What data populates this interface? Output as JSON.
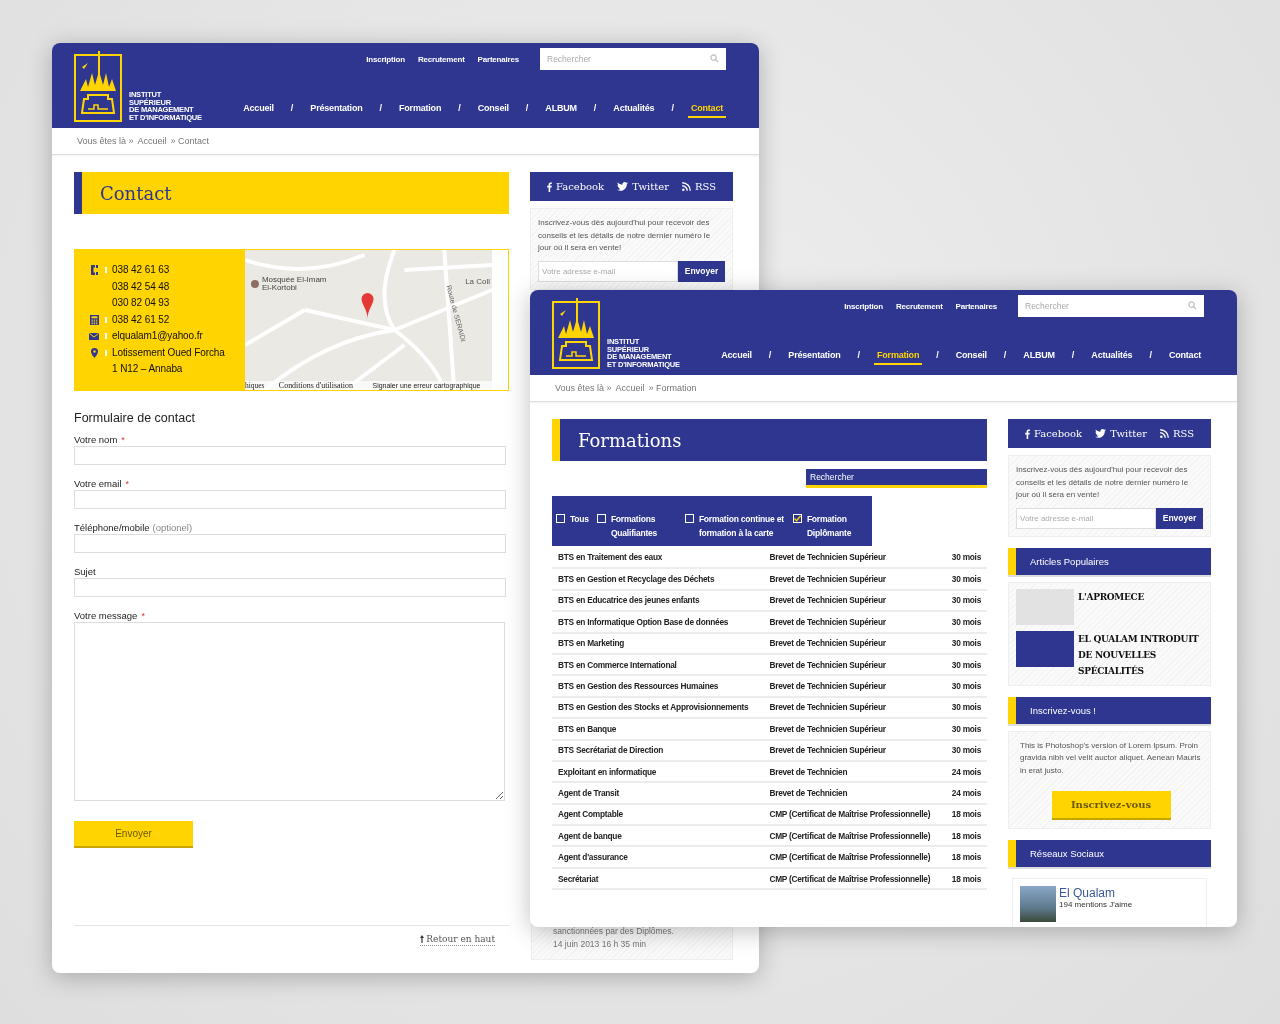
{
  "background_window": {
    "header": {
      "logo_lines": [
        "INSTITUT",
        "SUPÉRIEUR",
        "DE MANAGEMENT",
        "ET D'INFORMATIQUE"
      ],
      "top_links": [
        "Inscription",
        "Recrutement",
        "Partenaires"
      ],
      "search": {
        "placeholder": "Rechercher"
      },
      "nav": [
        {
          "label": "Accueil",
          "selected": false
        },
        {
          "label": "Présentation",
          "selected": false
        },
        {
          "label": "Formation",
          "selected": false
        },
        {
          "label": "Conseil",
          "selected": false
        },
        {
          "label": "ALBUM",
          "selected": false
        },
        {
          "label": "Actualités",
          "selected": false
        },
        {
          "label": "Contact",
          "selected": true
        }
      ],
      "separator": "/"
    },
    "breadcrumb": [
      "Vous êtes là »",
      "Accueil",
      "» Contact"
    ],
    "page_title": {
      "text": "Contact",
      "kind": "highlight"
    },
    "contact": [
      {
        "kind": "phone",
        "lines": [
          "038 42 61 63",
          "038 42 54 48",
          "030 82 04 93"
        ]
      },
      {
        "kind": "fax",
        "lines": [
          "038 42 61 52"
        ]
      },
      {
        "kind": "email",
        "lines": [
          "elqualam1@yahoo.fr"
        ]
      },
      {
        "kind": "address",
        "lines": [
          "Lotissement Oued Forcha",
          "1 N12 – Annaba"
        ]
      }
    ],
    "map": {
      "place": [
        "Mosquée El-Imam",
        "El-Kortobi"
      ],
      "edge_label": "La Coll",
      "road": "Route de SERAIDI",
      "footer": [
        "hiques",
        "Conditions d'utilisation",
        "Signaler une erreur cartographique"
      ]
    },
    "form": {
      "title": "Formulaire de contact",
      "fields": [
        {
          "label": "Votre nom",
          "marker": "*",
          "kind": "text"
        },
        {
          "label": "Votre email",
          "marker": "*",
          "kind": "text"
        },
        {
          "label": "Téléphone/mobile",
          "hint": "(optionel)",
          "kind": "text"
        },
        {
          "label": "Sujet",
          "kind": "text"
        },
        {
          "label": "Votre message",
          "marker": "*",
          "kind": "textarea"
        }
      ],
      "submit": "Envoyer"
    },
    "back_to_top": "Retour en haut",
    "sidebar": {
      "social": [
        {
          "kind": "facebook",
          "label": "Facebook"
        },
        {
          "kind": "twitter",
          "label": "Twitter"
        },
        {
          "kind": "rss",
          "label": "RSS"
        }
      ],
      "newsletter": {
        "text": "Inscrivez-vous dès aujourd'hui pour recevoir des conseils et les détails de notre dernier numéro le jour où il sera en vente!",
        "placeholder": "Votre adresse e-mail",
        "button": "Envoyer"
      },
      "post": {
        "excerpt": "sanctionnées par des Diplômes.",
        "date": "14 juin 2013 16 h 35 min"
      }
    }
  },
  "foreground_window": {
    "header": {
      "logo_lines": [
        "INSTITUT",
        "SUPÉRIEUR",
        "DE MANAGEMENT",
        "ET D'INFORMATIQUE"
      ],
      "top_links": [
        "Inscription",
        "Recrutement",
        "Partenaires"
      ],
      "search": {
        "placeholder": "Rechercher"
      },
      "nav": [
        {
          "label": "Accueil",
          "selected": false
        },
        {
          "label": "Présentation",
          "selected": false
        },
        {
          "label": "Formation",
          "selected": true
        },
        {
          "label": "Conseil",
          "selected": false
        },
        {
          "label": "ALBUM",
          "selected": false
        },
        {
          "label": "Actualités",
          "selected": false
        },
        {
          "label": "Contact",
          "selected": false
        }
      ],
      "separator": "/"
    },
    "breadcrumb": [
      "Vous êtes là »",
      "Accueil",
      "» Formation"
    ],
    "page_title": {
      "text": "Formations",
      "kind": "dark"
    },
    "search_bar": "Rechercher",
    "filters": [
      {
        "label": "Tous",
        "checked": false
      },
      {
        "label": "Formations Qualifiantes",
        "checked": false
      },
      {
        "label": "Formation continue et formation à la carte",
        "checked": false
      },
      {
        "label": "Formation Diplômante",
        "checked": true
      }
    ],
    "rows": [
      [
        "BTS en Traitement des eaux",
        "Brevet de Technicien Supérieur",
        "30 mois"
      ],
      [
        "BTS en Gestion et Recyclage des Déchets",
        "Brevet de Technicien Supérieur",
        "30 mois"
      ],
      [
        "BTS en Educatrice des jeunes enfants",
        "Brevet de Technicien Supérieur",
        "30 mois"
      ],
      [
        "BTS en Informatique Option Base de données",
        "Brevet de Technicien Supérieur",
        "30 mois"
      ],
      [
        "BTS en Marketing",
        "Brevet de Technicien Supérieur",
        "30 mois"
      ],
      [
        "BTS en Commerce International",
        "Brevet de Technicien Supérieur",
        "30 mois"
      ],
      [
        "BTS en Gestion des Ressources Humaines",
        "Brevet de Technicien Supérieur",
        "30 mois"
      ],
      [
        "BTS en Gestion des Stocks et Approvisionnements",
        "Brevet de Technicien Supérieur",
        "30 mois"
      ],
      [
        "BTS en Banque",
        "Brevet de Technicien Supérieur",
        "30 mois"
      ],
      [
        "BTS Secrétariat de Direction",
        "Brevet de Technicien Supérieur",
        "30 mois"
      ],
      [
        "Exploitant en informatique",
        "Brevet de Technicien",
        "24 mois"
      ],
      [
        "Agent de Transit",
        "Brevet de Technicien",
        "24 mois"
      ],
      [
        "Agent Comptable",
        "CMP (Certificat de Maîtrise Professionnelle)",
        "18 mois"
      ],
      [
        "Agent de banque",
        "CMP (Certificat de Maîtrise Professionnelle)",
        "18 mois"
      ],
      [
        "Agent d'assurance",
        "CMP (Certificat de Maîtrise Professionnelle)",
        "18 mois"
      ],
      [
        "Secrétariat",
        "CMP (Certificat de Maîtrise Professionnelle)",
        "18 mois"
      ]
    ],
    "sidebar": {
      "social": [
        {
          "kind": "facebook",
          "label": "Facebook"
        },
        {
          "kind": "twitter",
          "label": "Twitter"
        },
        {
          "kind": "rss",
          "label": "RSS"
        }
      ],
      "newsletter": {
        "text": "Inscrivez-vous dès aujourd'hui pour recevoir des conseils et les détails de notre dernier numéro le jour où il sera en vente!",
        "placeholder": "Votre adresse e-mail",
        "button": "Envoyer"
      },
      "popular": {
        "title": "Articles Populaires",
        "items": [
          {
            "title": "L'APROMECE",
            "kind": "light"
          },
          {
            "title": "EL QUALAM INTRODUIT DE NOUVELLES SPÉCIALITÉS",
            "kind": "dark"
          }
        ]
      },
      "signup": {
        "title": "Inscrivez-vous !",
        "text": "This is Photoshop's version of Lorem Ipsum. Proin gravida nibh vel velit auctor aliquet. Aenean Mauris in erat justo.",
        "button": "Inscrivez-vous"
      },
      "social_networks": {
        "title": "Réseaux Sociaux",
        "page": "El Qualam",
        "likes": "194 mentions J'aime"
      }
    }
  }
}
